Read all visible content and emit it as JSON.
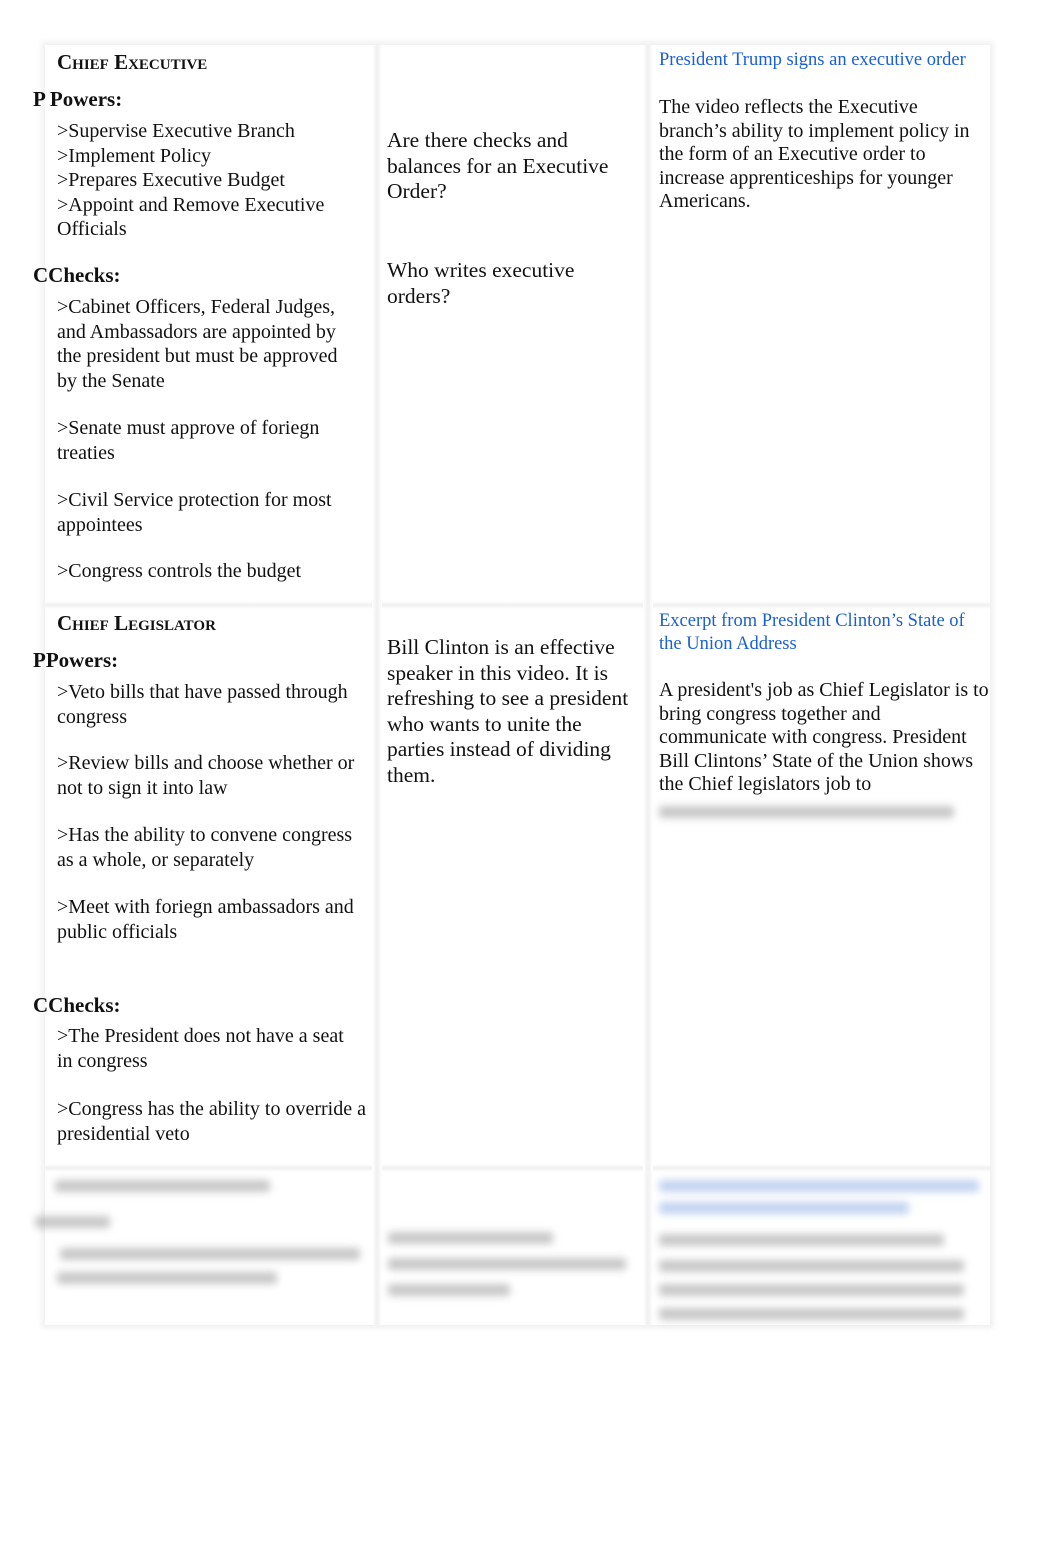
{
  "rows": [
    {
      "title": "Chief Executive",
      "powers_label": "P Powers:",
      "powers": ">Supervise Executive Branch\n>Implement Policy\n>Prepares Executive Budget\n>Appoint and Remove Executive Officials",
      "checks_label": "CChecks:",
      "checks": [
        ">Cabinet Officers, Federal Judges, and Ambassadors are appointed by the president but must be approved by the Senate",
        ">Senate must approve of foriegn treaties",
        ">Civil Service protection for most appointees",
        ">Congress controls the budget"
      ],
      "questions": [
        "Are there checks and balances for an Executive Order?",
        "Who writes executive orders?"
      ],
      "video_link": "President Trump signs an executive order",
      "reflection": "The video reflects the Executive branch’s ability to implement policy in the form of an Executive order to increase apprenticeships for younger Americans."
    },
    {
      "title": "Chief Legislator",
      "powers_label": "PPowers:",
      "powers": [
        ">Veto bills that have passed through congress",
        ">Review bills and choose whether or not to sign it into law",
        ">Has the ability to convene congress as a whole, or separately",
        ">Meet with foriegn ambassadors and public officials"
      ],
      "checks_label": "CChecks:",
      "checks": [
        ">The President does not have a seat in congress",
        ">Congress has the ability to override a presidential veto"
      ],
      "comment": "Bill Clinton is an effective speaker in this video. It is refreshing to see a president who wants to unite the parties instead of dividing them.",
      "video_link": "Excerpt from President Clinton’s State of the Union Address",
      "reflection": "A president's job as Chief Legislator is to bring congress together and communicate with congress. President Bill Clintons’ State of the Union shows the Chief legislators job to"
    }
  ],
  "colors": {
    "link": "#1a5fd6",
    "text": "#111111"
  }
}
